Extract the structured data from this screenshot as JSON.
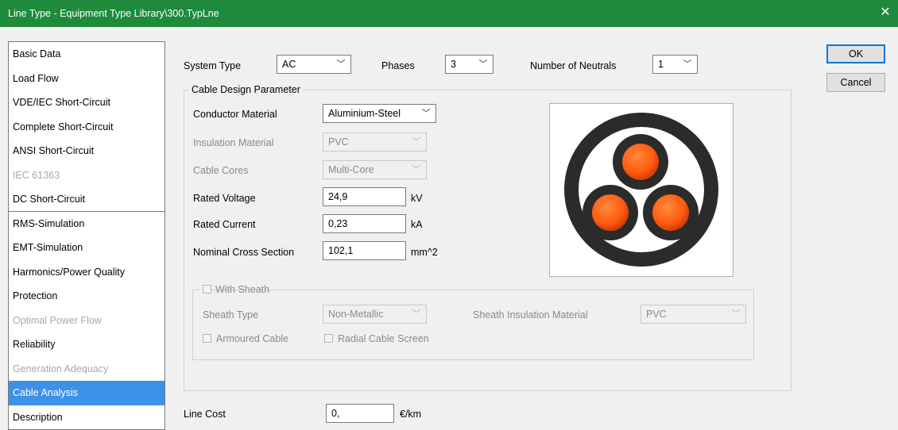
{
  "window": {
    "title": "Line Type - Equipment Type Library\\300.TypLne",
    "close_glyph": "✕"
  },
  "nav": {
    "items": [
      {
        "label": "Basic Data"
      },
      {
        "label": "Load Flow"
      },
      {
        "label": "VDE/IEC Short-Circuit"
      },
      {
        "label": "Complete Short-Circuit"
      },
      {
        "label": "ANSI Short-Circuit"
      },
      {
        "label": "IEC 61363"
      },
      {
        "label": "DC Short-Circuit"
      },
      {
        "label": "RMS-Simulation"
      },
      {
        "label": "EMT-Simulation"
      },
      {
        "label": "Harmonics/Power Quality"
      },
      {
        "label": "Protection"
      },
      {
        "label": "Optimal Power Flow"
      },
      {
        "label": "Reliability"
      },
      {
        "label": "Generation Adequacy"
      },
      {
        "label": "Cable Analysis"
      },
      {
        "label": "Description"
      }
    ],
    "selected": "Cable Analysis"
  },
  "top_row": {
    "system_type_label": "System Type",
    "system_type_value": "AC",
    "phases_label": "Phases",
    "phases_value": "3",
    "neutrals_label": "Number of Neutrals",
    "neutrals_value": "1"
  },
  "cable_design": {
    "group_title": "Cable Design Parameter",
    "conductor_material_label": "Conductor Material",
    "conductor_material_value": "Aluminium-Steel",
    "insulation_material_label": "Insulation Material",
    "insulation_material_value": "PVC",
    "cable_cores_label": "Cable Cores",
    "cable_cores_value": "Multi-Core",
    "rated_voltage_label": "Rated Voltage",
    "rated_voltage_value": "24,9",
    "rated_voltage_unit": "kV",
    "rated_current_label": "Rated Current",
    "rated_current_value": "0,23",
    "rated_current_unit": "kA",
    "cross_section_label": "Nominal Cross Section",
    "cross_section_value": "102,1",
    "cross_section_unit": "mm^2"
  },
  "sheath": {
    "with_sheath_label": "With Sheath",
    "sheath_type_label": "Sheath Type",
    "sheath_type_value": "Non-Metallic",
    "sheath_insulation_label": "Sheath Insulation Material",
    "sheath_insulation_value": "PVC",
    "armoured_label": "Armoured Cable",
    "radial_screen_label": "Radial Cable Screen"
  },
  "line_cost": {
    "label": "Line Cost",
    "value": "0,",
    "unit": "€/km"
  },
  "buttons": {
    "ok": "OK",
    "cancel": "Cancel"
  },
  "colors": {
    "titlebar": "#1f8a3c",
    "nav_selected": "#3d91e6",
    "conductor_orange": "#ff6a1a",
    "cable_jacket": "#2b2b2b"
  },
  "icons": {
    "dropdown": "chevron-down-icon",
    "close": "close-icon"
  }
}
